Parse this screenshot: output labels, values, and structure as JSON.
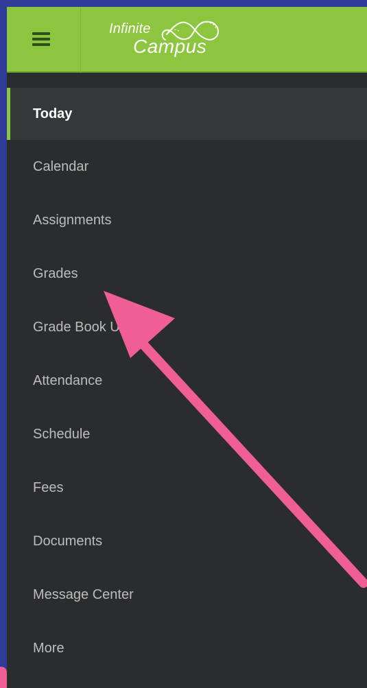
{
  "topbar": {
    "logo_line1": "Infinite",
    "logo_line2": "Campus",
    "menu_icon": "hamburger-menu-icon",
    "accent_color": "#8cc63f"
  },
  "nav": {
    "items": [
      {
        "label": "Today",
        "active": true
      },
      {
        "label": "Calendar",
        "active": false
      },
      {
        "label": "Assignments",
        "active": false
      },
      {
        "label": "Grades",
        "active": false
      },
      {
        "label": "Grade Book Updates",
        "active": false
      },
      {
        "label": "Attendance",
        "active": false
      },
      {
        "label": "Schedule",
        "active": false
      },
      {
        "label": "Fees",
        "active": false
      },
      {
        "label": "Documents",
        "active": false
      },
      {
        "label": "Message Center",
        "active": false
      },
      {
        "label": "More",
        "active": false
      }
    ]
  },
  "annotation": {
    "arrow_color": "#ef5f96",
    "target": "Grades"
  }
}
